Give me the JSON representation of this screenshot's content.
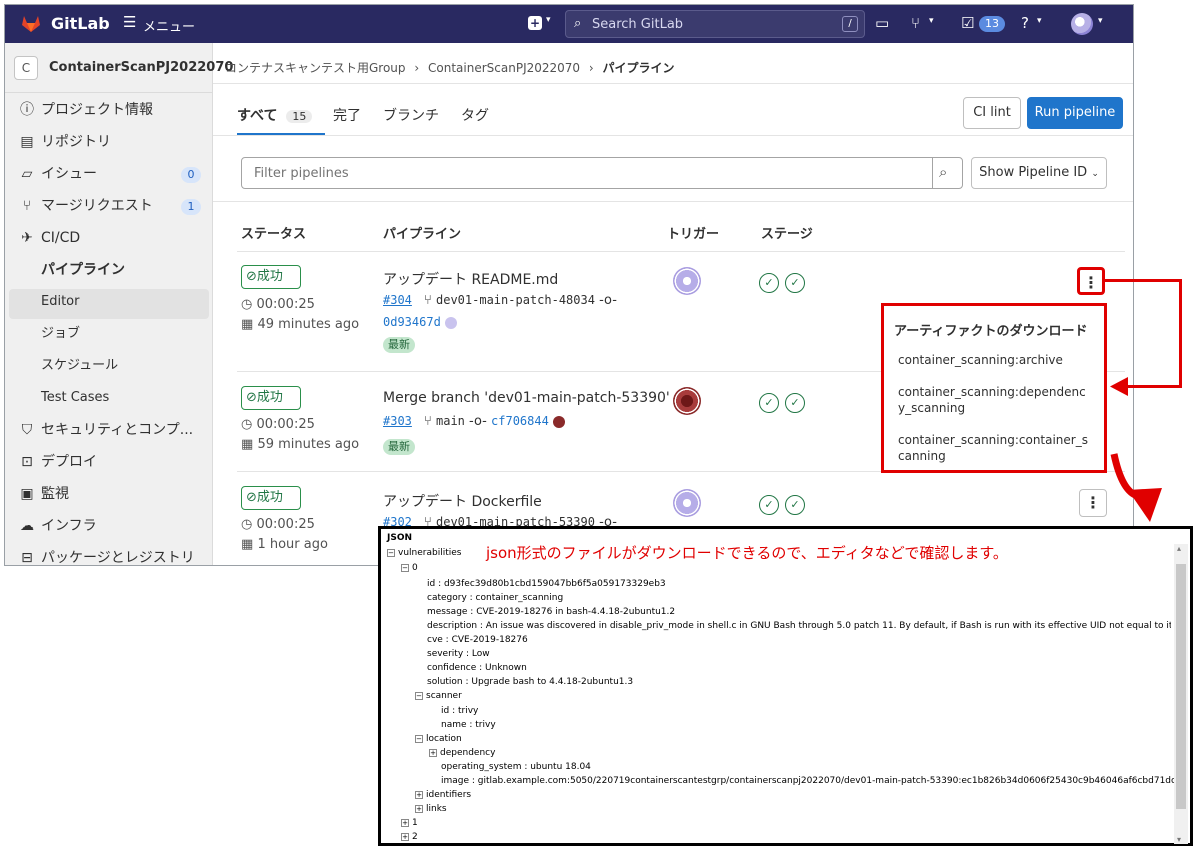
{
  "topbar": {
    "brand": "GitLab",
    "menu_label": "メニュー",
    "search_placeholder": "Search GitLab",
    "search_shortcut": "/",
    "todo_count": "13"
  },
  "sidebar": {
    "project_initial": "C",
    "project_name": "ContainerScanPJ2022070",
    "items": [
      {
        "label": "プロジェクト情報",
        "icon": "info-icon"
      },
      {
        "label": "リポジトリ",
        "icon": "book-icon"
      },
      {
        "label": "イシュー",
        "icon": "issue-icon",
        "count": "0"
      },
      {
        "label": "マージリクエスト",
        "icon": "merge-request-icon",
        "count": "1"
      },
      {
        "label": "CI/CD",
        "icon": "rocket-icon"
      },
      {
        "label": "パイプライン",
        "active": true
      },
      {
        "label": "Editor"
      },
      {
        "label": "ジョブ"
      },
      {
        "label": "スケジュール"
      },
      {
        "label": "Test Cases"
      },
      {
        "label": "セキュリティとコンプ...",
        "icon": "shield-icon"
      },
      {
        "label": "デプロイ",
        "icon": "deploy-icon"
      },
      {
        "label": "監視",
        "icon": "monitor-icon"
      },
      {
        "label": "インフラ",
        "icon": "cloud-gear-icon"
      },
      {
        "label": "パッケージとレジストリ",
        "icon": "package-icon"
      }
    ]
  },
  "breadcrumb": {
    "group": "コンテナスキャンテスト用Group",
    "project": "ContainerScanPJ2022070",
    "current": "パイプライン"
  },
  "tabs": [
    {
      "label": "すべて",
      "count": "15"
    },
    {
      "label": "完了"
    },
    {
      "label": "ブランチ"
    },
    {
      "label": "タグ"
    }
  ],
  "buttons": {
    "ci_lint": "CI lint",
    "run_pipeline": "Run pipeline",
    "show_id": "Show Pipeline ID"
  },
  "filter": {
    "placeholder": "Filter pipelines"
  },
  "table": {
    "headers": [
      "ステータス",
      "パイプライン",
      "トリガー",
      "ステージ"
    ]
  },
  "pipelines": [
    {
      "status": "成功",
      "duration": "00:00:25",
      "ago": "49 minutes ago",
      "title": "アップデート README.md",
      "id": "#304",
      "branch": "dev01-main-patch-48034",
      "commit": "0d93467d",
      "latest": "最新"
    },
    {
      "status": "成功",
      "duration": "00:00:25",
      "ago": "59 minutes ago",
      "title": "Merge branch 'dev01-main-patch-53390' ...",
      "id": "#303",
      "branch": "main",
      "commit": "cf706844",
      "latest": "最新"
    },
    {
      "status": "成功",
      "duration": "00:00:25",
      "ago": "1 hour ago",
      "title": "アップデート Dockerfile",
      "id": "#302",
      "branch": "dev01-main-patch-53390",
      "commit": ""
    }
  ],
  "dropdown": {
    "title": "アーティファクトのダウンロード",
    "items": [
      "container_scanning:archive",
      "container_scanning:dependency_scanning",
      "container_scanning:container_scanning"
    ]
  },
  "json_view": {
    "note": "json形式のファイルがダウンロードできるので、エディタなどで確認します。",
    "lines": [
      "JSON",
      "vulnerabilities",
      "0",
      "id : d93fec39d80b1cbd159047bb6f5a059173329eb3",
      "category : container_scanning",
      "message : CVE-2019-18276 in bash-4.4.18-2ubuntu1.2",
      "description : An issue was discovered in disable_priv_mode in shell.c in GNU Bash through 5.0 patch 11. By default, if Bash is run with its effective UID not equal to its real UID",
      "cve : CVE-2019-18276",
      "severity : Low",
      "confidence : Unknown",
      "solution : Upgrade bash to 4.4.18-2ubuntu1.3",
      "scanner",
      "id : trivy",
      "name : trivy",
      "location",
      "dependency",
      "operating_system : ubuntu 18.04",
      "image : gitlab.example.com:5050/220719containerscantestgrp/containerscanpj2022070/dev01-main-patch-53390:ec1b826b34d0606f25430c9b46046af6cbd71dca",
      "identifiers",
      "links",
      "1",
      "2"
    ]
  },
  "colors": {
    "topbar": "#292961",
    "accent": "#1f75cb",
    "success": "#217645",
    "annotation": "#e00000"
  }
}
